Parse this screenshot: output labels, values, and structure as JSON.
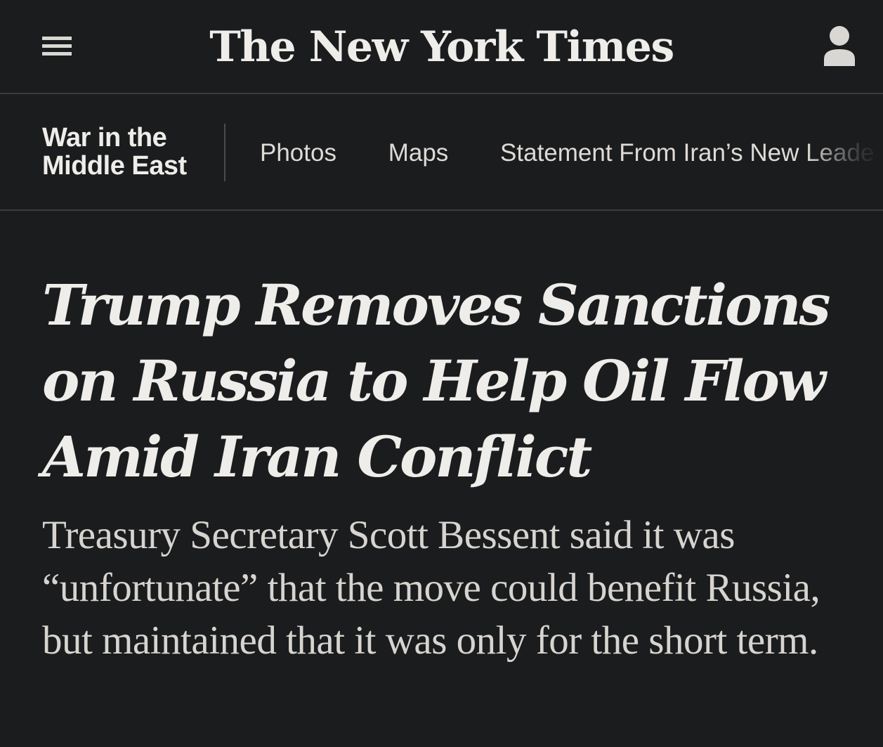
{
  "masthead": {
    "logo_text": "The New York Times",
    "menu_icon": "hamburger-menu-icon",
    "account_icon": "user-account-icon"
  },
  "section_nav": {
    "section_title": "War in the Middle East",
    "links": [
      {
        "label": "Photos"
      },
      {
        "label": "Maps"
      },
      {
        "label": "Statement From Iran’s New Leade"
      }
    ]
  },
  "article": {
    "headline": "Trump Removes Sanctions on Russia to Help Oil Flow Amid Iran Conflict",
    "summary": "Treasury Secretary Scott Bessent said it was “unfortunate” that the move could benefit Russia, but maintained that it was only for the short term."
  },
  "colors": {
    "background": "#1b1c1e",
    "text": "#efede9",
    "divider": "#3b3c3e"
  }
}
